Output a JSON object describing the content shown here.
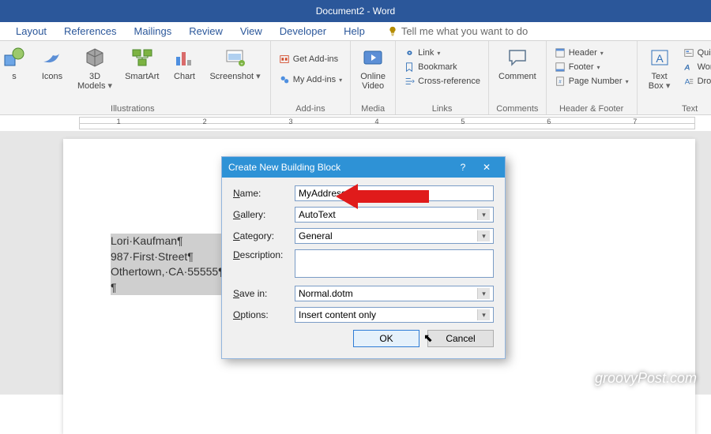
{
  "title": "Document2 - Word",
  "tabs": [
    "Layout",
    "References",
    "Mailings",
    "Review",
    "View",
    "Developer",
    "Help"
  ],
  "tell_me": "Tell me what you want to do",
  "ribbon": {
    "illustrations": {
      "label": "Illustrations",
      "icons": "Icons",
      "models": "3D\nModels",
      "smartart": "SmartArt",
      "chart": "Chart",
      "screenshot": "Screenshot"
    },
    "addins": {
      "label": "Add-ins",
      "get": "Get Add-ins",
      "my": "My Add-ins"
    },
    "media": {
      "label": "Media",
      "video": "Online\nVideo"
    },
    "links": {
      "label": "Links",
      "link": "Link",
      "bookmark": "Bookmark",
      "cross": "Cross-reference"
    },
    "comments": {
      "label": "Comments",
      "comment": "Comment"
    },
    "header_footer": {
      "label": "Header & Footer",
      "header": "Header",
      "footer": "Footer",
      "page": "Page Number"
    },
    "text": {
      "label": "Text",
      "textbox": "Text\nBox",
      "quick": "Quick Pa",
      "wordart": "WordArt",
      "dropcap": "Drop Cap"
    }
  },
  "ruler_numbers": [
    "1",
    "2",
    "3",
    "4",
    "5",
    "6",
    "7"
  ],
  "document": {
    "lines": [
      "Lori·Kaufman¶",
      "987·First·Street¶",
      "Othertown,·CA·55555¶",
      "¶"
    ]
  },
  "dialog": {
    "title": "Create New Building Block",
    "labels": {
      "name": "Name:",
      "gallery": "Gallery:",
      "category": "Category:",
      "description": "Description:",
      "savein": "Save in:",
      "options": "Options:"
    },
    "values": {
      "name": "MyAddress",
      "gallery": "AutoText",
      "category": "General",
      "description": "",
      "savein": "Normal.dotm",
      "options": "Insert content only"
    },
    "ok": "OK",
    "cancel": "Cancel"
  },
  "watermark": "groovyPost.com"
}
